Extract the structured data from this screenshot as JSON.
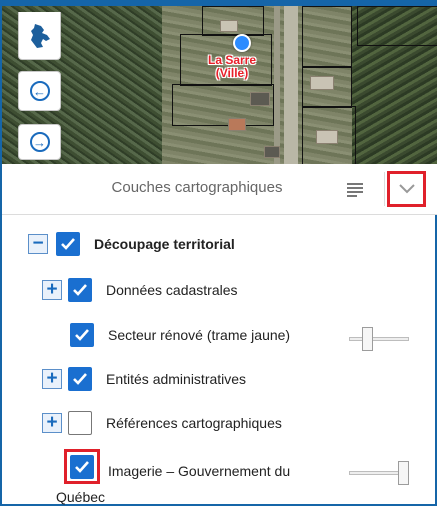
{
  "map": {
    "place_label": "La Sarre (Ville)",
    "buttons": [
      "quebec-map-icon",
      "arrow-left-icon",
      "arrow-right-icon"
    ]
  },
  "panel": {
    "title": "Couches cartographiques",
    "icons": [
      "list-icon",
      "chevron-down-icon"
    ]
  },
  "layers": [
    {
      "label": "Découpage territorial",
      "checked": true,
      "toggle": "−",
      "bold": true
    },
    {
      "label": "Données cadastrales",
      "checked": true,
      "toggle": "+"
    },
    {
      "label": "Secteur rénové (trame jaune)",
      "checked": true,
      "opacity": 0.25
    },
    {
      "label": "Entités administratives",
      "checked": true,
      "toggle": "+"
    },
    {
      "label": "Références cartographiques",
      "checked": false,
      "toggle": "+"
    },
    {
      "label": "Imagerie – Gouvernement du Québec",
      "checked": true,
      "opacity": 1.0
    }
  ],
  "colors": {
    "accent": "#1a6fd0",
    "highlight": "#e0202a",
    "frame": "#1565a8"
  }
}
